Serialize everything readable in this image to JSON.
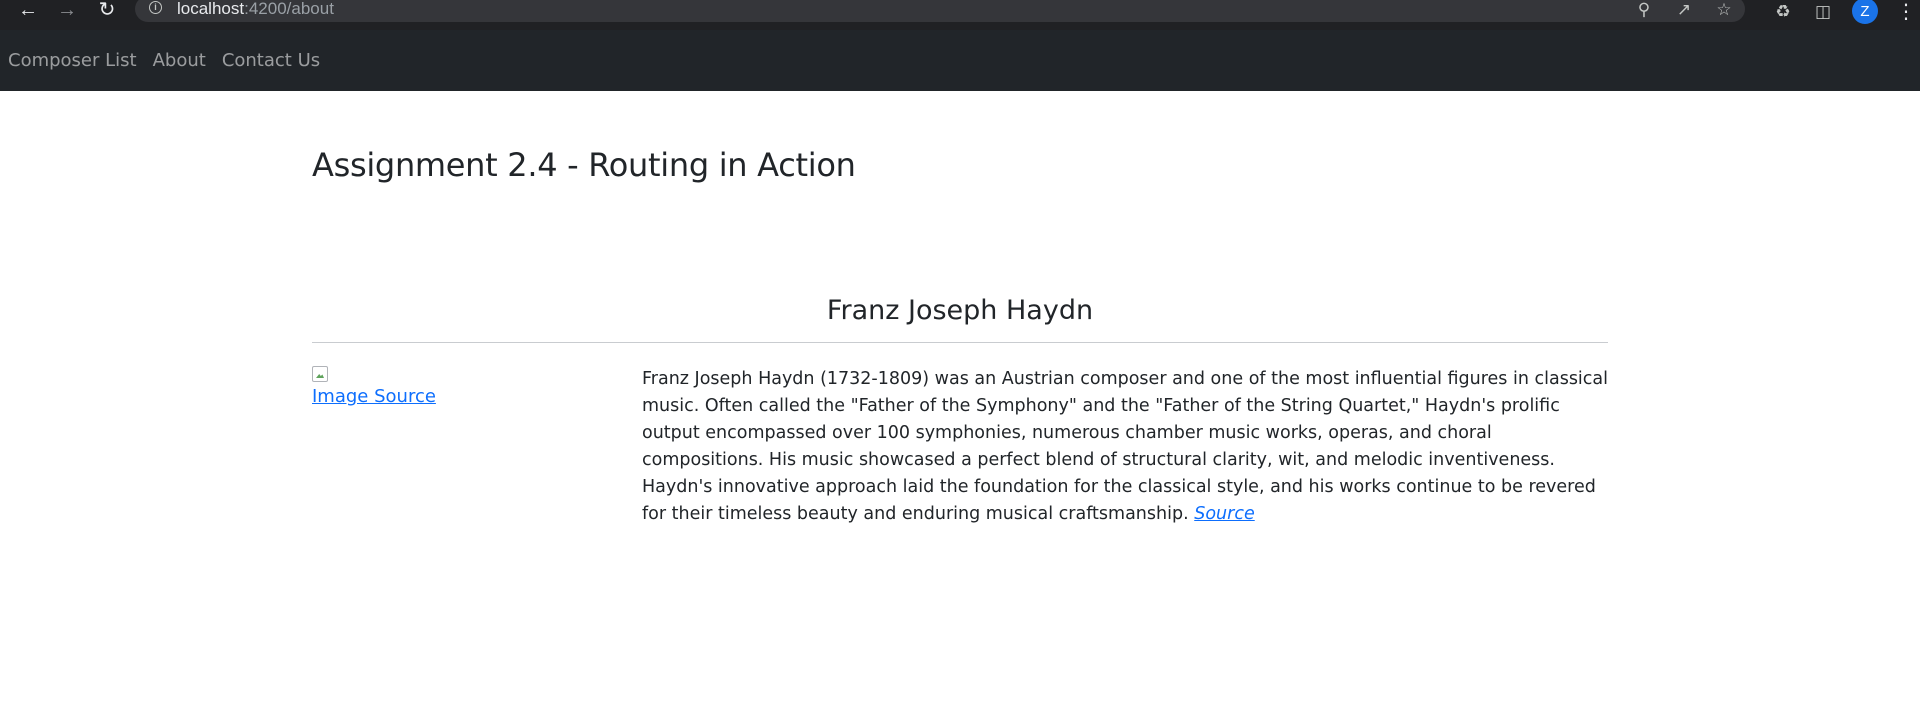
{
  "browser": {
    "url_host": "localhost",
    "url_path": ":4200/about",
    "profile_initial": "Z"
  },
  "navbar": {
    "links": [
      "Composer List",
      "About",
      "Contact Us"
    ]
  },
  "page": {
    "title": "Assignment 2.4 - Routing in Action"
  },
  "composer": {
    "name": "Franz Joseph Haydn",
    "image_source_label": "Image Source",
    "bio": "Franz Joseph Haydn (1732-1809) was an Austrian composer and one of the most influential figures in classical music. Often called the \"Father of the Symphony\" and the \"Father of the String Quartet,\" Haydn's prolific output encompassed over 100 symphonies, numerous chamber music works, operas, and choral compositions. His music showcased a perfect blend of structural clarity, wit, and melodic inventiveness. Haydn's innovative approach laid the foundation for the classical style, and his works continue to be revered for their timeless beauty and enduring musical craftsmanship.",
    "source_label": "Source"
  },
  "colors": {
    "navbar_bg": "#212529",
    "link": "#0d6efd",
    "browser_bg": "#202124"
  }
}
